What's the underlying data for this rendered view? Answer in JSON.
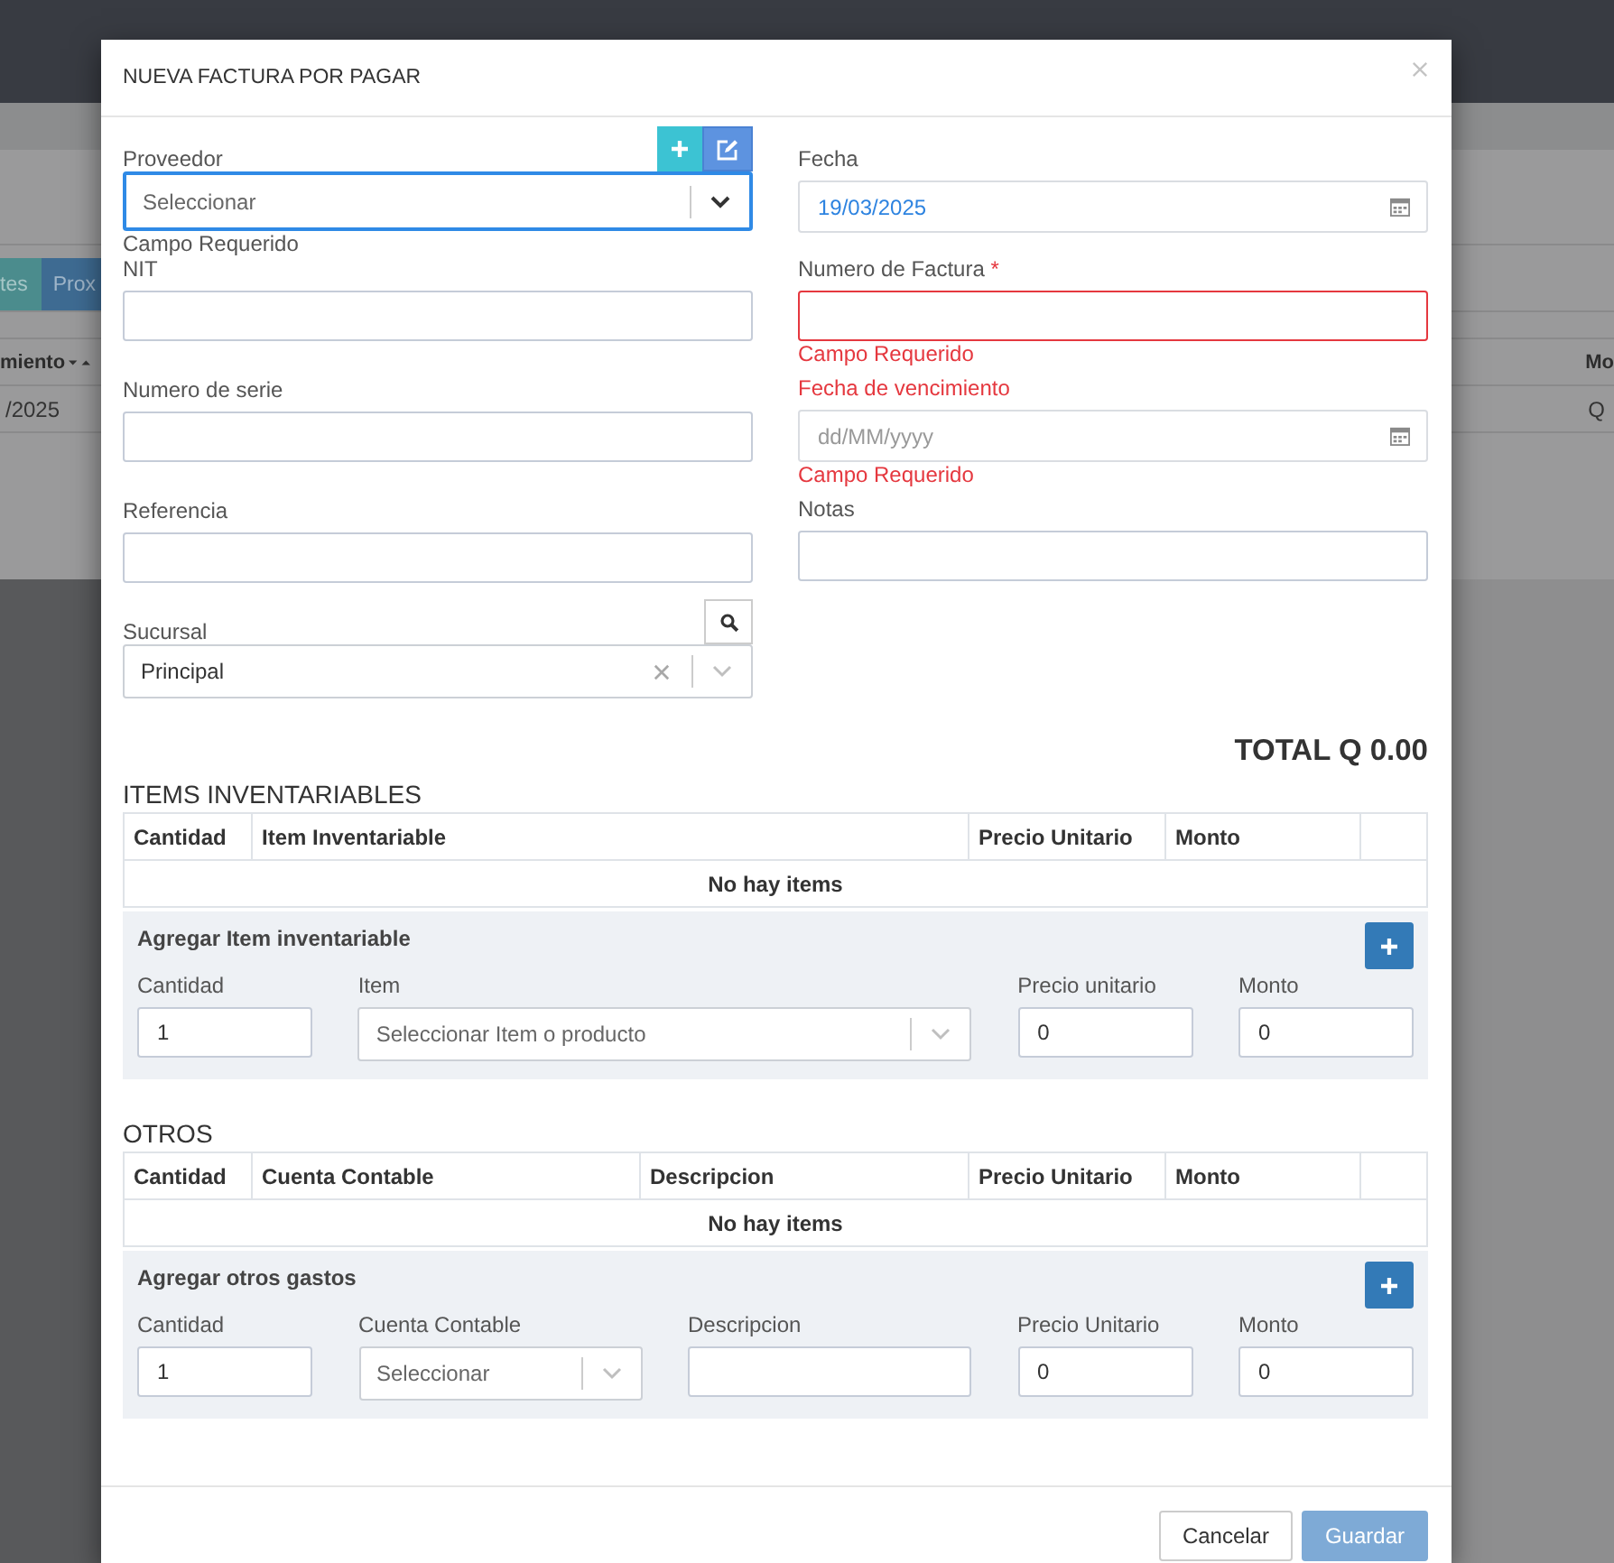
{
  "background": {
    "tabs": [
      {
        "label": "tes",
        "color": "#4b8c8d"
      },
      {
        "label": "Prox",
        "color": "#3e6b92"
      }
    ],
    "left_table": {
      "header": "miento",
      "cell": "/2025"
    },
    "right_table": {
      "header": "Mo",
      "cell": "Q"
    }
  },
  "modal": {
    "title": "NUEVA FACTURA POR PAGAR",
    "left_fields": [
      {
        "kind": "select",
        "label": "Proveedor",
        "placeholder": "Seleccionar",
        "actions": [
          {
            "kind": "add"
          },
          {
            "kind": "edit"
          }
        ],
        "clearable": false,
        "focused": true,
        "invalid": false,
        "message": "Campo Requerido"
      },
      {
        "kind": "text",
        "label": "NIT",
        "focused": false,
        "invalid": false
      },
      {
        "kind": "text",
        "label": "Numero de serie",
        "focused": false,
        "invalid": false
      },
      {
        "kind": "text",
        "label": "Referencia",
        "focused": false,
        "invalid": false
      },
      {
        "kind": "select",
        "label": "Sucursal",
        "value": "Principal",
        "actions": [
          {
            "kind": "search"
          }
        ],
        "clearable": true,
        "focused": false,
        "invalid": false
      }
    ],
    "right_fields": [
      {
        "kind": "date",
        "label": "Fecha",
        "value": "19/03/2025",
        "focused": false,
        "invalid": false
      },
      {
        "kind": "text",
        "label": "Numero de Factura",
        "required_mark": "*",
        "focused": false,
        "invalid": true,
        "message": "Campo Requerido"
      },
      {
        "kind": "date",
        "label": "Fecha de vencimiento",
        "placeholder": "dd/MM/yyyy",
        "focused": false,
        "invalid": true,
        "message": "Campo Requerido"
      },
      {
        "kind": "text",
        "label": "Notas",
        "focused": false,
        "invalid": false
      }
    ],
    "total": "TOTAL Q 0.00",
    "sections": [
      {
        "kind": "inventory",
        "title": "ITEMS INVENTARIABLES",
        "columns": [
          "Cantidad",
          "Item Inventariable",
          "Precio Unitario",
          "Monto"
        ],
        "empty_message": "No hay items",
        "add_form": {
          "title": "Agregar Item inventariable",
          "fields": [
            {
              "kind": "text",
              "label": "Cantidad",
              "value": "1"
            },
            {
              "kind": "select",
              "label": "Item",
              "placeholder": "Seleccionar Item o producto"
            },
            {
              "kind": "text",
              "label": "Precio unitario",
              "value": "0"
            },
            {
              "kind": "text",
              "label": "Monto",
              "value": "0"
            }
          ]
        }
      },
      {
        "kind": "expenses",
        "title": "OTROS",
        "columns": [
          "Cantidad",
          "Cuenta Contable",
          "Descripcion",
          "Precio Unitario",
          "Monto"
        ],
        "empty_message": "No hay items",
        "add_form": {
          "title": "Agregar otros gastos",
          "fields": [
            {
              "kind": "text",
              "label": "Cantidad",
              "value": "1"
            },
            {
              "kind": "select",
              "label": "Cuenta Contable",
              "placeholder": "Seleccionar"
            },
            {
              "kind": "text",
              "label": "Descripcion"
            },
            {
              "kind": "text",
              "label": "Precio Unitario",
              "value": "0"
            },
            {
              "kind": "text",
              "label": "Monto",
              "value": "0"
            }
          ]
        }
      }
    ],
    "buttons": [
      {
        "label": "Cancelar",
        "kind": "secondary",
        "disabled": false
      },
      {
        "label": "Guardar",
        "kind": "primary",
        "disabled": true
      }
    ]
  }
}
